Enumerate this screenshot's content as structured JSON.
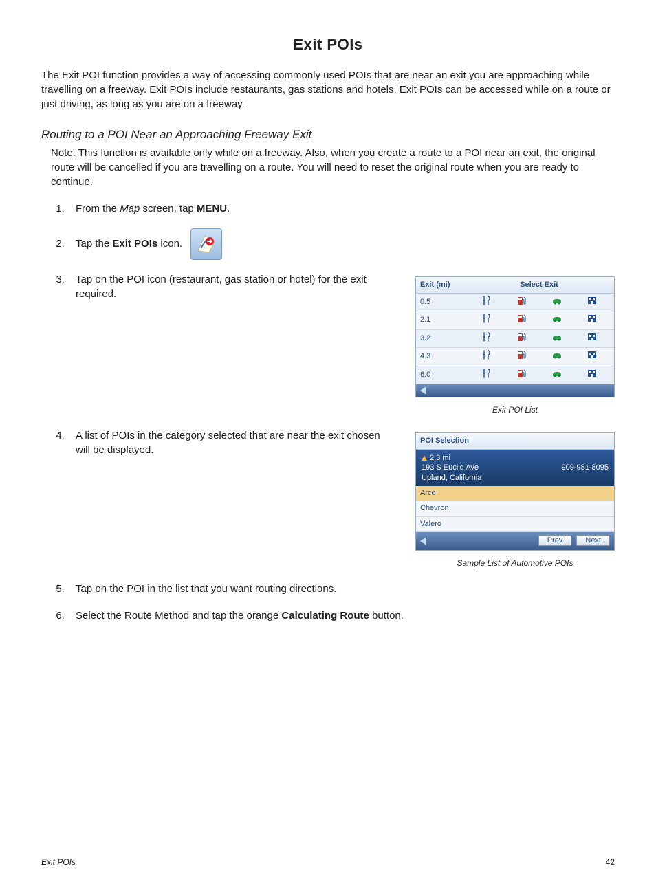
{
  "title": "Exit POIs",
  "intro": "The Exit POI function provides a way of accessing commonly used POIs that are near an exit you are approaching while travelling on a freeway.  Exit POIs include restaurants, gas stations and hotels.  Exit POIs can be accessed while on a route or just driving, as long as you are on a freeway.",
  "subhead": "Routing to a POI Near an Approaching Freeway Exit",
  "note": "Note: This function is available only while on a freeway.  Also, when you create a route to a POI near an exit, the original route will be cancelled if you are travelling on a route.  You will need to reset the original route when you are ready to continue.",
  "steps": {
    "s1_a": "From the ",
    "s1_b": "Map",
    "s1_c": " screen, tap ",
    "s1_d": "MENU",
    "s1_e": ".",
    "s2_a": "Tap the ",
    "s2_b": "Exit POIs",
    "s2_c": " icon.",
    "s3": "Tap on the POI icon (restaurant, gas station or hotel) for the exit required.",
    "s4": "A list of POIs in the category selected that are near the exit chosen will be displayed.",
    "s5": "Tap on the POI in the list that you want routing directions.",
    "s6_a": "Select the Route Method and tap the orange ",
    "s6_b": "Calculating Route",
    "s6_c": " button."
  },
  "panel1": {
    "hdr_left": "Exit   (mi)",
    "hdr_right": "Select Exit",
    "rows": [
      "0.5",
      "2.1",
      "3.2",
      "4.3",
      "6.0"
    ],
    "caption": "Exit POI List"
  },
  "panel2": {
    "hdr": "POI Selection",
    "dist": "2.3 mi",
    "addr1": "193 S Euclid Ave",
    "addr2": "Upland, California",
    "phone": "909-981-8095",
    "items": [
      "Arco",
      "Chevron",
      "Valero"
    ],
    "prev": "Prev",
    "next": "Next",
    "caption": "Sample List of Automotive POIs"
  },
  "footer": {
    "left": "Exit POIs",
    "page": "42"
  }
}
